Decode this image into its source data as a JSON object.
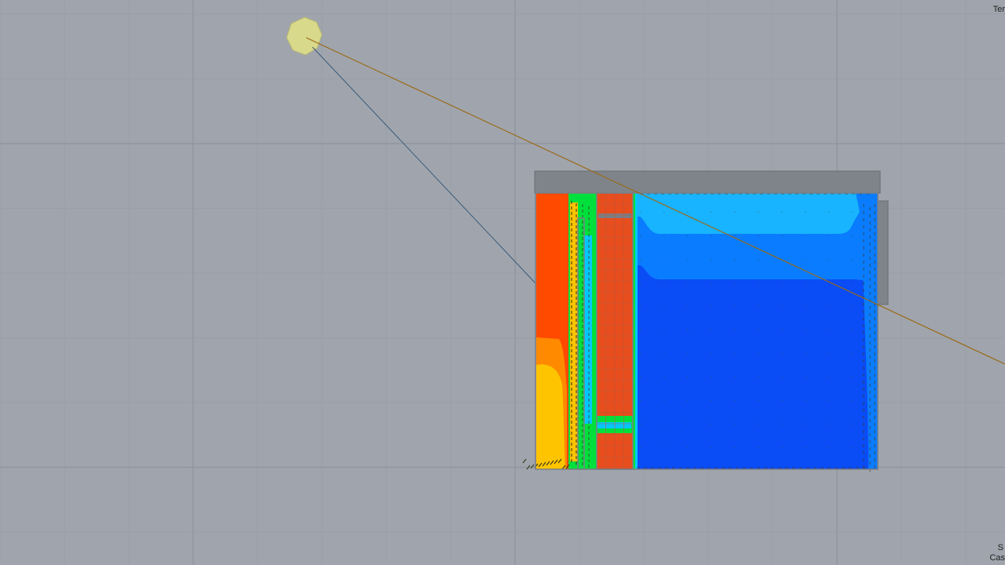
{
  "viewport": {
    "top_right_label": "Ter",
    "bottom_right_label_1": "S",
    "bottom_right_label_2": "Cas"
  },
  "colors": {
    "background": "#a0a5ad",
    "grid_major": "#8e949c",
    "grid_minor": "#989da5",
    "wall_frame": "#7b7f86",
    "hot": "#ff4a00",
    "hot_dark": "#e84d1d",
    "warm": "#ff8a00",
    "yellow": "#ffc400",
    "green": "#00e03c",
    "cyan": "#00c8ff",
    "light_blue": "#18b4ff",
    "mid_blue": "#0a7cff",
    "deep_blue": "#0a4cf5",
    "sun_sphere": "#d9d98c",
    "sun_ray": "#9a6a18",
    "view_ray": "#3a5a78",
    "vector": "#3b3a1e"
  },
  "scene": {
    "sun_icon": "sun-sphere",
    "result_field": "temperature-contour"
  }
}
